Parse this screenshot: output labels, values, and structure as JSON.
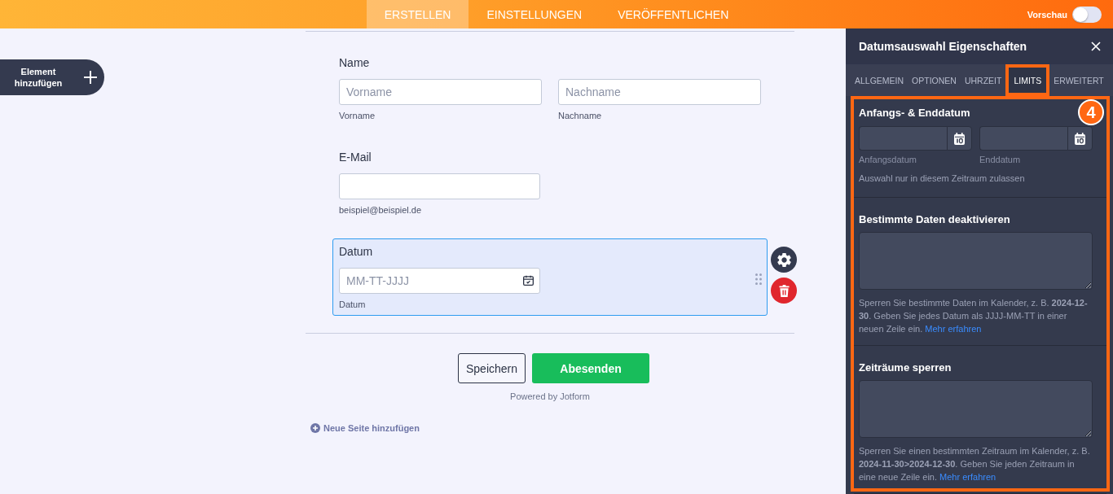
{
  "topbar": {
    "tabs": [
      {
        "label": "ERSTELLEN",
        "selected": true
      },
      {
        "label": "EINSTELLUNGEN",
        "selected": false
      },
      {
        "label": "VERÖFFENTLICHEN",
        "selected": false
      }
    ],
    "preview": {
      "label": "Vorschau",
      "on": false
    }
  },
  "sidebar": {
    "add_element_button": "Element hinzufügen"
  },
  "form": {
    "fields": [
      {
        "kind": "name",
        "label": "Name",
        "selected": false,
        "inputs": [
          {
            "placeholder": "Vorname",
            "sublabel": "Vorname"
          },
          {
            "placeholder": "Nachname",
            "sublabel": "Nachname"
          }
        ]
      },
      {
        "kind": "email",
        "label": "E-Mail",
        "selected": false,
        "inputs": [
          {
            "sublabel": "beispiel@beispiel.de"
          }
        ]
      },
      {
        "kind": "date",
        "label": "Datum",
        "selected": true,
        "inputs": [
          {
            "placeholder": "MM-TT-JJJJ",
            "sublabel": "Datum"
          }
        ]
      }
    ],
    "buttons": [
      {
        "kind": "save",
        "label": "Speichern"
      },
      {
        "kind": "submit",
        "label": "Abesenden"
      }
    ],
    "powered_by": "Powered by Jotform",
    "add_page_link": "Neue Seite hinzufügen"
  },
  "properties_panel": {
    "title": "Datumsauswahl Eigenschaften",
    "tabs": [
      {
        "label": "ALLGEMEIN",
        "selected": false,
        "highlighted": false
      },
      {
        "label": "OPTIONEN",
        "selected": false,
        "highlighted": false
      },
      {
        "label": "UHRZEIT",
        "selected": false,
        "highlighted": false
      },
      {
        "label": "LIMITS",
        "selected": true,
        "highlighted": true
      },
      {
        "label": "ERWEITERT",
        "selected": false,
        "highlighted": false
      }
    ],
    "highlighted": true,
    "step_badge": "4",
    "sections": [
      {
        "kind": "date_range",
        "title": "Anfangs- & Enddatum",
        "inputs": [
          {
            "label": "Anfangsdatum"
          },
          {
            "label": "Enddatum"
          }
        ],
        "help": "Auswahl nur in diesem Zeitraum zulassen"
      },
      {
        "kind": "text_list",
        "title": "Bestimmte Daten deaktivieren",
        "help": "Sperren Sie bestimmte Daten im Kalender, z. B. **2024-12-30**. Geben Sie jedes Datum als JJJJ-MM-TT in einer neuen Zeile ein.",
        "link": "Mehr erfahren"
      },
      {
        "kind": "text_list",
        "title": "Zeiträume sperren",
        "help": "Sperren Sie einen bestimmten Zeitraum im Kalender, z. B. **2024-11-30>2024-12-30**. Geben Sie jeden Zeitraum in eine neue Zeile ein.",
        "link": "Mehr erfahren"
      }
    ]
  }
}
